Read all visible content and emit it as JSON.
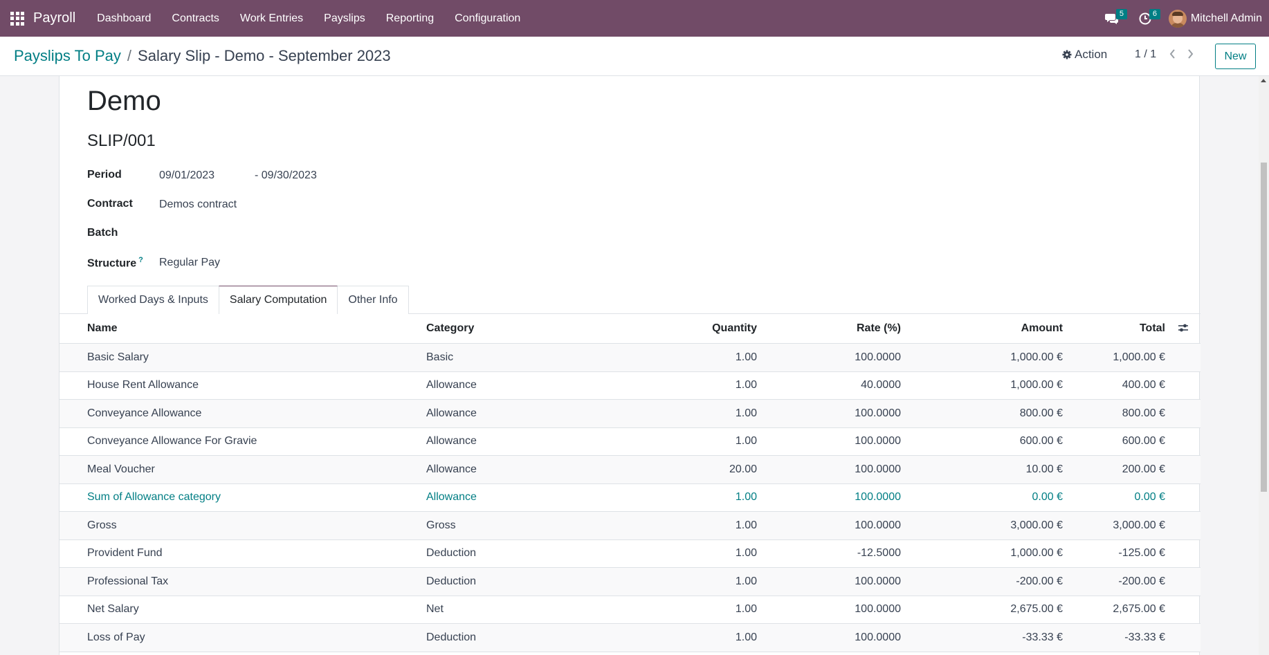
{
  "navbar": {
    "app_name": "Payroll",
    "menu": [
      "Dashboard",
      "Contracts",
      "Work Entries",
      "Payslips",
      "Reporting",
      "Configuration"
    ],
    "messages_count": "5",
    "activities_count": "6",
    "user_name": "Mitchell Admin"
  },
  "control": {
    "breadcrumb_parent": "Payslips To Pay",
    "breadcrumb_separator": "/",
    "breadcrumb_current": "Salary Slip - Demo - September 2023",
    "action_label": "Action",
    "pager": "1 / 1",
    "new_label": "New"
  },
  "form": {
    "employee_name": "Demo",
    "reference": "SLIP/001",
    "period_label": "Period",
    "period_start": "09/01/2023",
    "period_end": "- 09/30/2023",
    "contract_label": "Contract",
    "contract_value": "Demos contract",
    "batch_label": "Batch",
    "batch_value": "",
    "structure_label": "Structure",
    "structure_help": "?",
    "structure_value": "Regular Pay"
  },
  "tabs": [
    "Worked Days & Inputs",
    "Salary Computation",
    "Other Info"
  ],
  "active_tab": "Salary Computation",
  "table": {
    "columns": [
      "Name",
      "Category",
      "Quantity",
      "Rate (%)",
      "Amount",
      "Total"
    ],
    "rows": [
      {
        "name": "Basic Salary",
        "category": "Basic",
        "quantity": "1.00",
        "rate": "100.0000",
        "amount": "1,000.00 €",
        "total": "1,000.00 €"
      },
      {
        "name": "House Rent Allowance",
        "category": "Allowance",
        "quantity": "1.00",
        "rate": "40.0000",
        "amount": "1,000.00 €",
        "total": "400.00 €"
      },
      {
        "name": "Conveyance Allowance",
        "category": "Allowance",
        "quantity": "1.00",
        "rate": "100.0000",
        "amount": "800.00 €",
        "total": "800.00 €"
      },
      {
        "name": "Conveyance Allowance For Gravie",
        "category": "Allowance",
        "quantity": "1.00",
        "rate": "100.0000",
        "amount": "600.00 €",
        "total": "600.00 €"
      },
      {
        "name": "Meal Voucher",
        "category": "Allowance",
        "quantity": "20.00",
        "rate": "100.0000",
        "amount": "10.00 €",
        "total": "200.00 €"
      },
      {
        "name": "Sum of Allowance category",
        "category": "Allowance",
        "quantity": "1.00",
        "rate": "100.0000",
        "amount": "0.00 €",
        "total": "0.00 €"
      },
      {
        "name": "Gross",
        "category": "Gross",
        "quantity": "1.00",
        "rate": "100.0000",
        "amount": "3,000.00 €",
        "total": "3,000.00 €"
      },
      {
        "name": "Provident Fund",
        "category": "Deduction",
        "quantity": "1.00",
        "rate": "-12.5000",
        "amount": "1,000.00 €",
        "total": "-125.00 €"
      },
      {
        "name": "Professional Tax",
        "category": "Deduction",
        "quantity": "1.00",
        "rate": "100.0000",
        "amount": "-200.00 €",
        "total": "-200.00 €"
      },
      {
        "name": "Net Salary",
        "category": "Net",
        "quantity": "1.00",
        "rate": "100.0000",
        "amount": "2,675.00 €",
        "total": "2,675.00 €"
      },
      {
        "name": "Loss of Pay",
        "category": "Deduction",
        "quantity": "1.00",
        "rate": "100.0000",
        "amount": "-33.33 €",
        "total": "-33.33 €"
      }
    ]
  },
  "colors": {
    "navbar_bg": "#714b67",
    "accent": "#017e84",
    "text": "#212529"
  },
  "icons": [
    "apps-grid-icon",
    "chat-icon",
    "clock-icon",
    "gear-icon",
    "chevron-left-icon",
    "chevron-right-icon",
    "column-settings-icon"
  ]
}
